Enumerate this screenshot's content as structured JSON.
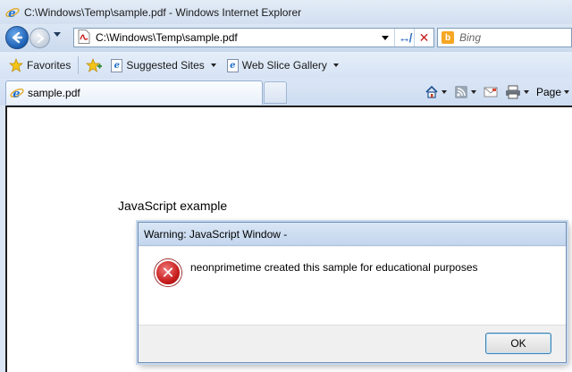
{
  "window": {
    "title": "C:\\Windows\\Temp\\sample.pdf - Windows Internet Explorer"
  },
  "navigation": {
    "address": "C:\\Windows\\Temp\\sample.pdf",
    "refresh_icon": "↮",
    "stop_icon": "✕",
    "search_placeholder": "Bing"
  },
  "favorites_bar": {
    "favorites_label": "Favorites",
    "items": [
      {
        "label": "Suggested Sites"
      },
      {
        "label": "Web Slice Gallery"
      }
    ]
  },
  "tabs": [
    {
      "label": "sample.pdf",
      "active": true
    }
  ],
  "command_bar": {
    "page_label": "Page"
  },
  "page": {
    "heading": "JavaScript example"
  },
  "dialog": {
    "title": "Warning: JavaScript Window -",
    "message": "neonprimetime created this sample for educational purposes",
    "ok_label": "OK",
    "icon": "error-icon"
  },
  "colors": {
    "accent": "#1b5fb3",
    "error": "#c81d1d"
  }
}
